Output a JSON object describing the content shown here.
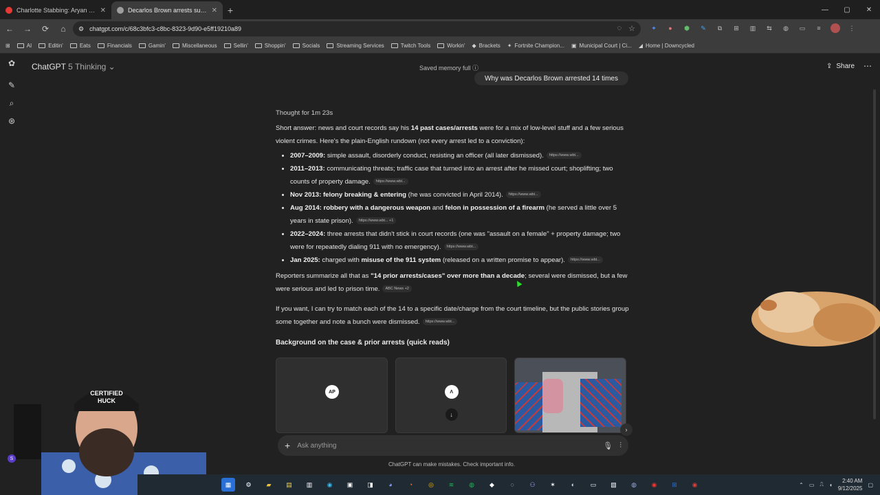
{
  "browser": {
    "tabs": [
      {
        "title": "Charlotte Stabbing: Aryan Prisc",
        "favicon_color": "#e53935",
        "active": false
      },
      {
        "title": "Decarlos Brown arrests summ",
        "favicon_color": "#9e9e9e",
        "active": true
      }
    ],
    "new_tab": "+",
    "window_controls": {
      "minimize": "—",
      "maximize": "▢",
      "close": "✕"
    },
    "url": "chatgpt.com/c/68c3bfc3-c8bc-8323-9d90-e5ff19210a89",
    "nav": {
      "back": "←",
      "forward": "→",
      "reload": "⟳",
      "home": "⌂"
    },
    "bookmarks": [
      "AI",
      "Editin'",
      "Eats",
      "Financials",
      "Gamin'",
      "Miscellaneous",
      "Sellin'",
      "Shoppin'",
      "Socials",
      "Streaming Services",
      "Twitch Tools",
      "Workin'",
      "Brackets",
      "Fortnite Champion...",
      "Municipal Court | Ci...",
      "Home | Downcycled"
    ]
  },
  "app": {
    "model_name": "ChatGPT",
    "model_variant": "5 Thinking",
    "memory_status": "Saved memory full",
    "share_label": "Share",
    "more_label": "⋯",
    "user_message": "Why was Decarlos Brown arrested 14 times",
    "thought": "Thought for 1m 23s",
    "intro": {
      "a": "Short answer: news and court records say his ",
      "b": "14 past cases/arrests",
      "c": " were for a mix of low-level stuff and a few serious violent crimes. Here's the plain-English rundown (not every arrest led to a conviction):"
    },
    "bullets": [
      {
        "bold": "2007–2009:",
        "text": " simple assault, disorderly conduct, resisting an officer (all later dismissed).",
        "cite": "https://www.wbt..."
      },
      {
        "bold": "2011–2013:",
        "text": " communicating threats; traffic case that turned into an arrest after he missed court; shoplifting; two counts of property damage.",
        "cite": "https://www.wbt..."
      },
      {
        "bold": "Nov 2013: felony breaking & entering",
        "text": " (he was convicted in April 2014).",
        "cite": "https://www.wbt..."
      },
      {
        "bold": "Aug 2014: robbery with a dangerous weapon",
        "mid": " and ",
        "bold2": "felon in possession of a firearm",
        "text": " (he served a little over 5 years in state prison).",
        "cite": "https://www.wbt...  +1"
      },
      {
        "bold": "2022–2024:",
        "text": " three arrests that didn't stick in court records (one was \"assault on a female\" + property damage; two were for repeatedly dialing 911 with no emergency).",
        "cite": "https://www.wbt..."
      },
      {
        "bold": "Jan 2025:",
        "text": " charged with ",
        "bold2": "misuse of the 911 system",
        "tail": " (released on a written promise to appear).",
        "cite": "https://www.wbt..."
      }
    ],
    "summary": {
      "a": "Reporters summarize all that as ",
      "b": "\"14 prior arrests/cases\" over more than a decade",
      "c": "; several were dismissed, but a few were serious and led to prison time.",
      "cite": "ABC News  +2"
    },
    "followup": {
      "text": "If you want, I can try to match each of the 14 to a specific date/charge from the court timeline, but the public stories group some together and note a bunch were dismissed.",
      "cite": "https://www.wbt..."
    },
    "background_title": "Background on the case & prior arrests (quick reads)",
    "cards": [
      {
        "logo": "AP"
      },
      {
        "logo": "Λ",
        "download": "↓"
      },
      {
        "image": "train interior"
      }
    ],
    "composer_placeholder": "Ask anything",
    "disclaimer": "ChatGPT can make mistakes. Check important info."
  },
  "taskbar": {
    "time": "2:40 AM",
    "date": "9/12/2025"
  },
  "overlay": {
    "webcam_hat_text": [
      "CERTIFIED",
      "HUCK"
    ],
    "profile_initial": "S"
  }
}
